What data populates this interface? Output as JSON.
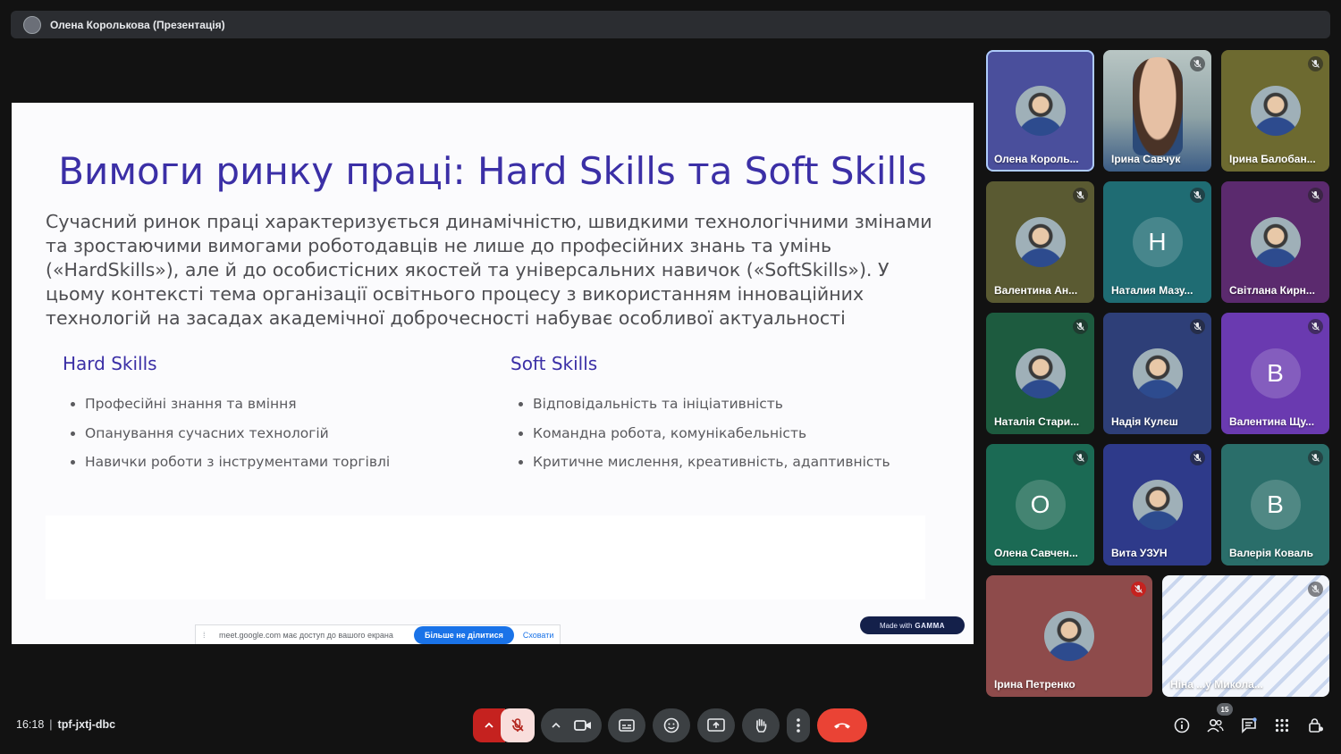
{
  "presentation": {
    "title": "Олена Королькова (Презентація)"
  },
  "slide": {
    "title": "Вимоги ринку праці: Hard Skills та Soft Skills",
    "intro": "Сучасний ринок праці характеризується динамічністю, швидкими технологічними змінами та зростаючими вимогами роботодавців не лише до професійних знань та умінь («HardSkills»), але й до особистісних якостей та універсальних навичок («SoftSkills»). У цьому контексті тема організації освітнього процесу з використанням інноваційних технологій на засадах академічної доброчесності набуває особливої актуальності",
    "hard": {
      "heading": "Hard Skills",
      "items": [
        "Професійні знання та вміння",
        "Опанування сучасних технологій",
        "Навички роботи з інструментами торгівлі"
      ]
    },
    "soft": {
      "heading": "Soft Skills",
      "items": [
        "Відповідальність та ініціативність",
        "Командна робота, комунікабельність",
        "Критичне мислення, креативність, адаптивність"
      ]
    },
    "badge_prefix": "Made with",
    "badge_brand": "GAMMA"
  },
  "share_banner": {
    "message": "meet.google.com має доступ до вашого екрана",
    "stop_label": "Більше не ділитися",
    "hide_label": "Сховати"
  },
  "participants": [
    {
      "name": "Олена Король...",
      "avatar": "photo",
      "color": "#4a4f9c"
    },
    {
      "name": "Ірина Савчук",
      "avatar": "video",
      "color": "#8aa2a8"
    },
    {
      "name": "Ірина Балобан...",
      "avatar": "photo",
      "color": "#6d6a30"
    },
    {
      "name": "Валентина Ан...",
      "avatar": "photo",
      "color": "#5a5a32"
    },
    {
      "name": "Наталия Мазу...",
      "avatar": "letter",
      "letter": "Н",
      "color": "#1f6c73"
    },
    {
      "name": "Світлана Кирн...",
      "avatar": "photo",
      "color": "#5b2a6e"
    },
    {
      "name": "Наталія Стари...",
      "avatar": "photo",
      "color": "#1d5b3f"
    },
    {
      "name": "Надія Кулєш",
      "avatar": "photo",
      "color": "#2e3f78"
    },
    {
      "name": "Валентина Щу...",
      "avatar": "letter",
      "letter": "В",
      "color": "#6a3ab0"
    },
    {
      "name": "Олена Савчен...",
      "avatar": "letter",
      "letter": "О",
      "color": "#1b6a54"
    },
    {
      "name": "Вита УЗУН",
      "avatar": "photo",
      "color": "#2e3a8a"
    },
    {
      "name": "Валерія Коваль",
      "avatar": "letter",
      "letter": "В",
      "color": "#2a6e6a"
    },
    {
      "name": "Ірина Петренко",
      "avatar": "photo",
      "color": "#8e4b4b"
    },
    {
      "name": "Ніна ...у Микола...",
      "avatar": "screen",
      "color": "#e9eef8"
    }
  ],
  "meeting": {
    "time": "16:18",
    "code": "tpf-jxtj-dbc",
    "participants_count": "15"
  },
  "colors": {
    "accent": "#3b2fa6",
    "end_call": "#ea4335",
    "background": "#121212"
  }
}
